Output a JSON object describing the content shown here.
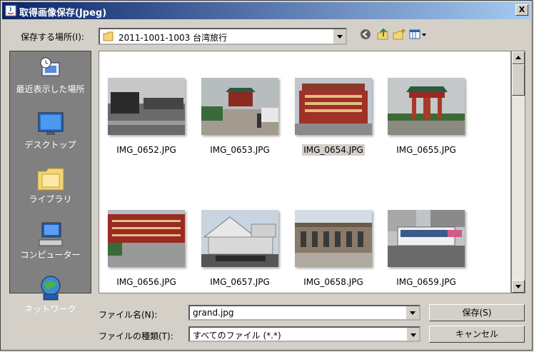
{
  "window": {
    "title": "取得画像保存(Jpeg)",
    "close_label": "X"
  },
  "lookin": {
    "label": "保存する場所(I):",
    "value": "2011-1001-1003 台湾旅行"
  },
  "places": [
    {
      "label": "最近表示した場所"
    },
    {
      "label": "デスクトップ"
    },
    {
      "label": "ライブラリ"
    },
    {
      "label": "コンピューター"
    },
    {
      "label": "ネットワーク"
    }
  ],
  "files": [
    {
      "name": "IMG_0652.JPG",
      "selected": false
    },
    {
      "name": "IMG_0653.JPG",
      "selected": false
    },
    {
      "name": "IMG_0654.JPG",
      "selected": true
    },
    {
      "name": "IMG_0655.JPG",
      "selected": false
    },
    {
      "name": "IMG_0656.JPG",
      "selected": false
    },
    {
      "name": "IMG_0657.JPG",
      "selected": false
    },
    {
      "name": "IMG_0658.JPG",
      "selected": false
    },
    {
      "name": "IMG_0659.JPG",
      "selected": false
    }
  ],
  "filename": {
    "label": "ファイル名(N):",
    "value": "grand.jpg"
  },
  "filetype": {
    "label": "ファイルの種類(T):",
    "value": "すべてのファイル (*.*)"
  },
  "buttons": {
    "save": "保存(S)",
    "cancel": "キャンセル"
  },
  "colors": {
    "titlebar_start": "#0a246a",
    "titlebar_end": "#a6caf0",
    "places_bg": "#808080"
  }
}
